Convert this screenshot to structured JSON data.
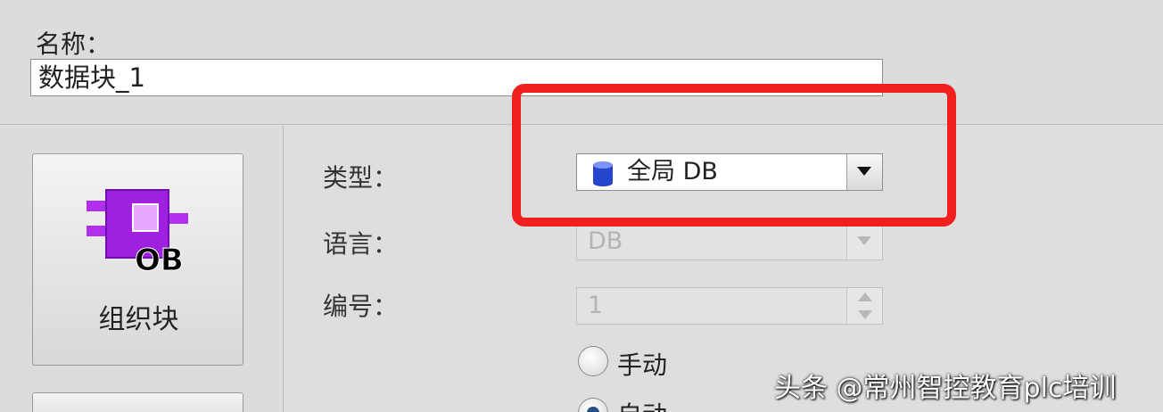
{
  "name_field": {
    "label": "名称：",
    "value": "数据块_1"
  },
  "block_types": [
    {
      "label": "组织块",
      "badge": "OB"
    }
  ],
  "form": {
    "type": {
      "label": "类型：",
      "value": "全局 DB"
    },
    "language": {
      "label": "语言：",
      "value": "DB"
    },
    "number": {
      "label": "编号：",
      "value": "1"
    },
    "numbering_options": [
      {
        "label": "手动",
        "checked": false
      },
      {
        "label": "自动",
        "checked": true
      }
    ]
  },
  "watermark": "头条 @常州智控教育plc培训",
  "colors": {
    "highlight": "#f0201f",
    "ob_block": "#a020e0",
    "db_icon": "#2545d0"
  }
}
